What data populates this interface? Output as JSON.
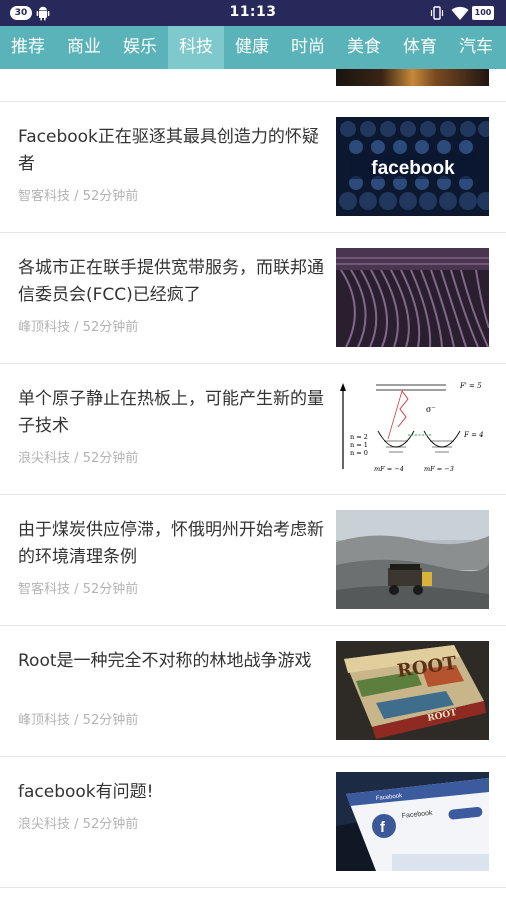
{
  "status_bar": {
    "notification_count": "30",
    "time": "11:13",
    "battery": "100"
  },
  "tabs": [
    {
      "label": "推荐"
    },
    {
      "label": "商业"
    },
    {
      "label": "娱乐"
    },
    {
      "label": "科技",
      "active": true
    },
    {
      "label": "健康"
    },
    {
      "label": "时尚"
    },
    {
      "label": "美食"
    },
    {
      "label": "体育"
    },
    {
      "label": "汽车"
    }
  ],
  "articles": [
    {
      "title": "Facebook正在驱逐其最具创造力的怀疑者",
      "source": "智客科技",
      "time": "52分钟前",
      "image": "facebook-logo-wall",
      "image_text": "facebook"
    },
    {
      "title": "各城市正在联手提供宽带服务，而联邦通信委员会(FCC)已经疯了",
      "source": "峰顶科技",
      "time": "52分钟前",
      "image": "network-cables"
    },
    {
      "title": "单个原子静止在热板上，可能产生新的量子技术",
      "source": "浪尖科技",
      "time": "52分钟前",
      "image": "quantum-energy-diagram",
      "diagram": {
        "top_label": "F' = 5",
        "sigma": "σ⁻",
        "levels": [
          "n = 2",
          "n = 1",
          "n = 0"
        ],
        "right_label": "F = 4",
        "bottom_left": "mF = −4",
        "bottom_right": "mF = −3"
      }
    },
    {
      "title": "由于煤炭供应停滞，怀俄明州开始考虑新的环境清理条例",
      "source": "智客科技",
      "time": "52分钟前",
      "image": "coal-mine-truck"
    },
    {
      "title": "Root是一种完全不对称的林地战争游戏",
      "source": "峰顶科技",
      "time": "52分钟前",
      "image": "root-board-game",
      "image_text": "ROOT"
    },
    {
      "title": "facebook有问题!",
      "source": "浪尖科技",
      "time": "52分钟前",
      "image": "facebook-app-phone",
      "image_text": "Facebook"
    }
  ],
  "meta_separator": " / "
}
